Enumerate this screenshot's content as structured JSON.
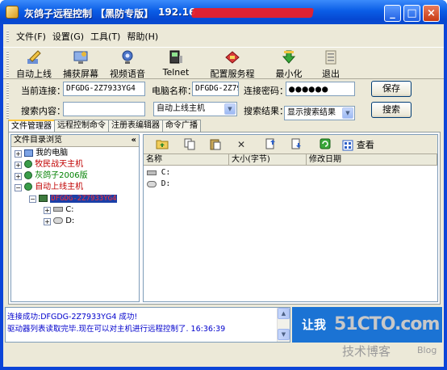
{
  "window": {
    "title": "灰鸽子远程控制 【黑防专版】",
    "ip_prefix": "192.16"
  },
  "menu": [
    "文件(F)",
    "设置(G)",
    "工具(T)",
    "帮助(H)"
  ],
  "toolbar": [
    {
      "label": "自动上线",
      "icon": "pencil-icon"
    },
    {
      "label": "捕获屏幕",
      "icon": "screen-icon"
    },
    {
      "label": "视频语音",
      "icon": "webcam-icon"
    },
    {
      "label": "Telnet",
      "icon": "terminal-icon"
    },
    {
      "label": "配置服务程序",
      "icon": "config-icon"
    },
    {
      "label": "最小化",
      "icon": "minimize-icon"
    },
    {
      "label": "退出",
      "icon": "exit-icon"
    }
  ],
  "connection": {
    "current_label": "当前连接：",
    "current_value": "DFGDG-2Z7933YG4",
    "computer_label": "电脑名称：",
    "computer_value": "DFGDG-2Z793",
    "password_label": "连接密码：",
    "password_value": "●●●●●●",
    "save_label": "保存"
  },
  "search": {
    "content_label": "搜索内容：",
    "content_value": "",
    "scope_value": "自动上线主机",
    "result_label": "搜索结果：",
    "result_value": "显示搜索结果",
    "button_label": "搜索"
  },
  "tabs": [
    "文件管理器",
    "远程控制命令",
    "注册表编辑器",
    "命令广播"
  ],
  "tree": {
    "header": "文件目录浏览",
    "collapse": "«",
    "items": [
      {
        "label": "我的电脑",
        "color": "#000000"
      },
      {
        "label": "牧民战天主机",
        "color": "#c00000"
      },
      {
        "label": "灰鸽子2006版",
        "color": "#008000"
      },
      {
        "label": "自动上线主机",
        "color": "#c00000"
      },
      {
        "label": "DFGDG-2Z7933YG4",
        "color": "#ff3030"
      },
      {
        "label": "C:",
        "color": "#000000"
      },
      {
        "label": "D:",
        "color": "#000000"
      }
    ]
  },
  "file_toolbar": {
    "view_label": "查看"
  },
  "files": {
    "columns": [
      "名称",
      "大小(字节)",
      "修改日期"
    ],
    "rows": [
      "C:",
      "D:"
    ]
  },
  "log": [
    "连接成功:DFGDG-2Z7933YG4 成功!",
    "驱动器列表读取完毕.现在可以对主机进行远程控制了. 16:36:39"
  ],
  "banner": "让我",
  "watermark": {
    "site": "51CTO.com",
    "blog_cn": "技术博客",
    "blog_en": "Blog"
  }
}
